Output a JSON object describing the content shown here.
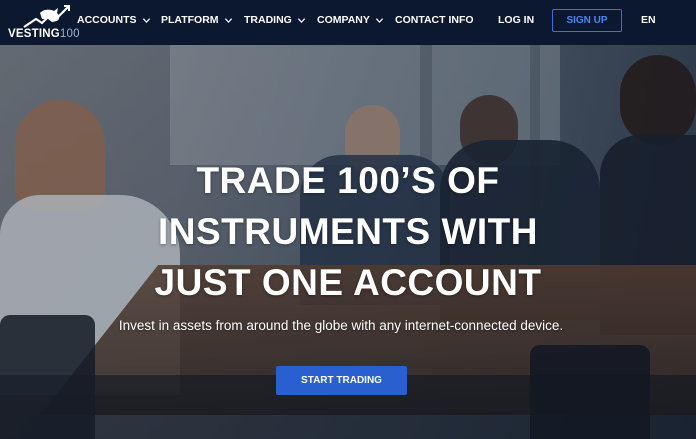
{
  "brand": {
    "name": "VESTING",
    "number": "100"
  },
  "nav": {
    "items": [
      {
        "label": "ACCOUNTS",
        "dropdown": true
      },
      {
        "label": "PLATFORM",
        "dropdown": true
      },
      {
        "label": "TRADING",
        "dropdown": true
      },
      {
        "label": "COMPANY",
        "dropdown": true
      },
      {
        "label": "CONTACT INFO",
        "dropdown": false
      }
    ],
    "login_label": "LOG IN",
    "signup_label": "SIGN UP",
    "language": "EN"
  },
  "hero": {
    "headline_lines": [
      "TRADE 100’S OF",
      "INSTRUMENTS WITH",
      "JUST ONE ACCOUNT"
    ],
    "subtitle": "Invest in assets from around the globe with any internet-connected device.",
    "cta_label": "START TRADING"
  },
  "colors": {
    "nav_bg": "#0c1730",
    "accent": "#2a5fd0",
    "signup_border": "#3b6fd6"
  },
  "icons": [
    "bull-logo-icon",
    "chevron-down-icon"
  ]
}
